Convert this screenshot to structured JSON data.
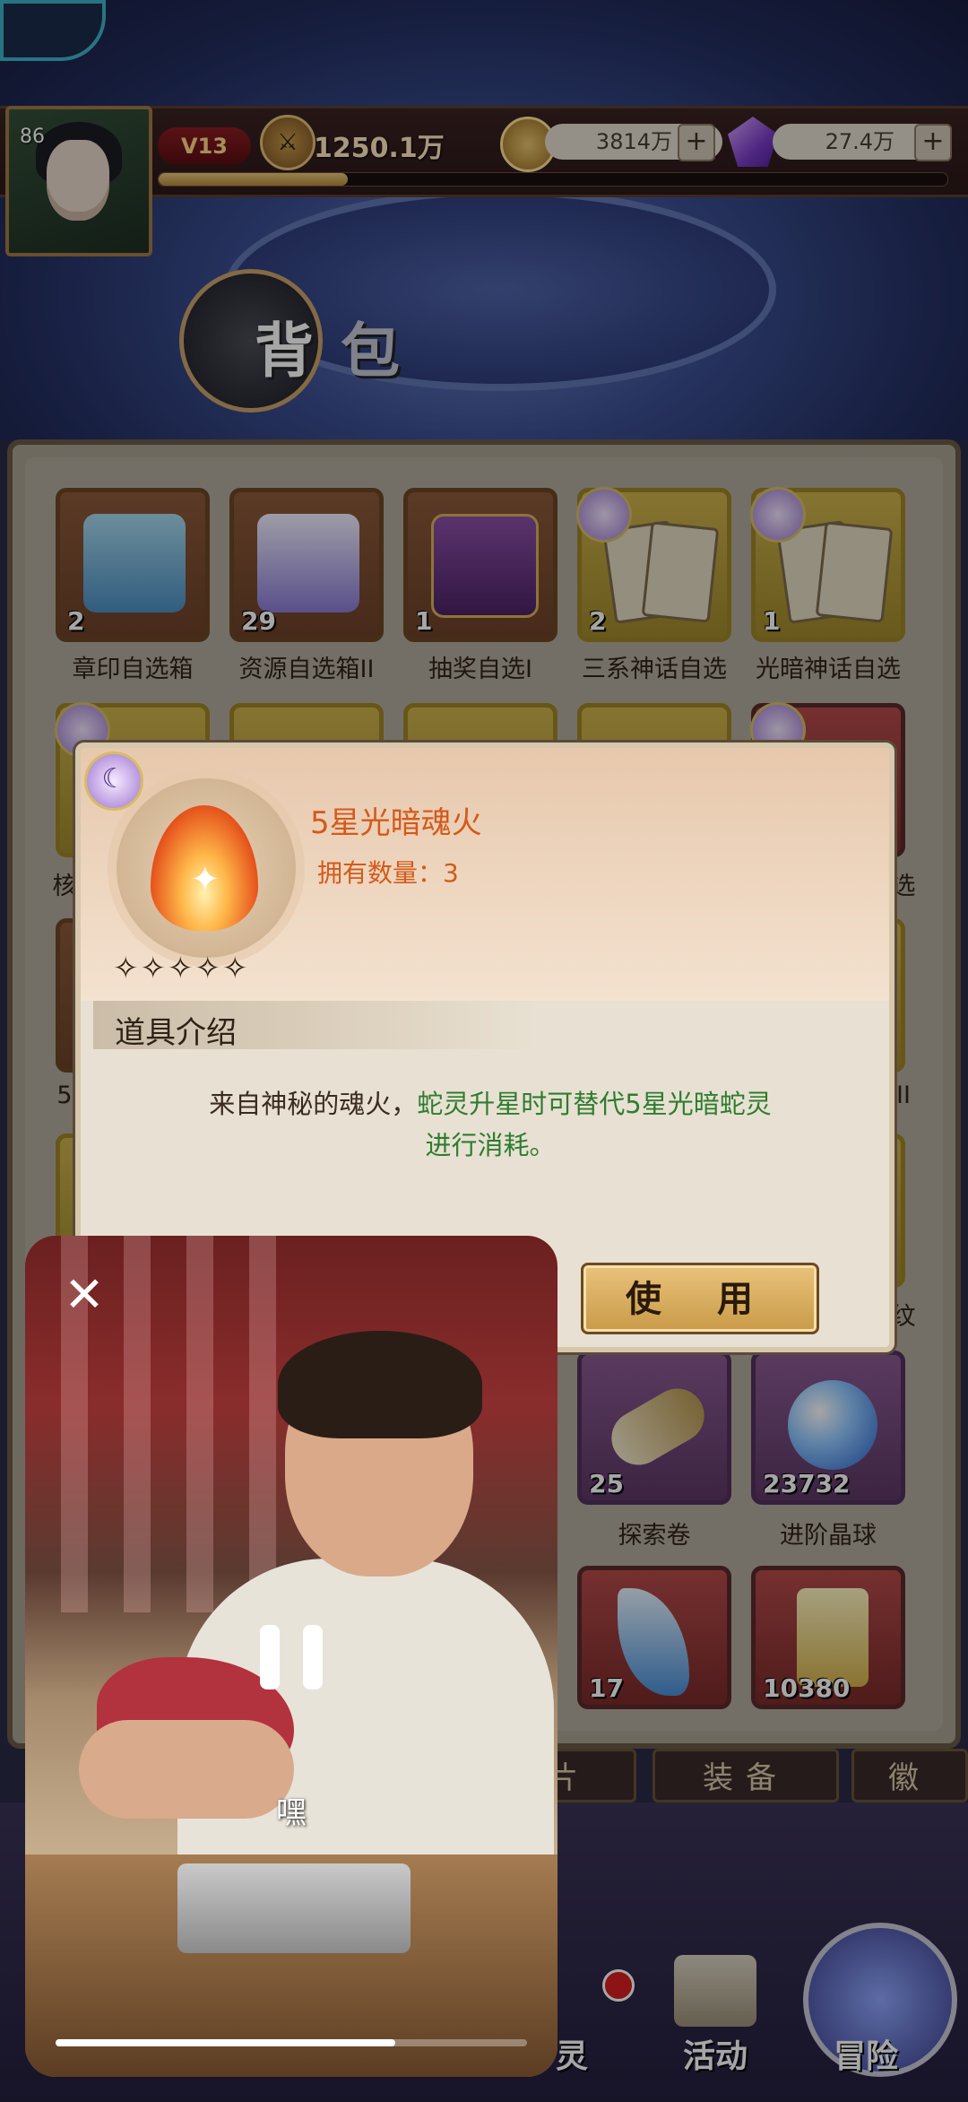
{
  "header": {
    "level": "86",
    "vip": "V13",
    "power": "1250.1万",
    "gold": "3814万",
    "gems": "27.4万",
    "plus": "+",
    "exp_progress": 0.24
  },
  "page_title": {
    "char1": "背",
    "char2": "包"
  },
  "bag": {
    "row1": [
      {
        "count": "2",
        "label": "章印自选箱"
      },
      {
        "count": "29",
        "label": "资源自选箱II"
      },
      {
        "count": "1",
        "label": "抽奖自选I"
      },
      {
        "count": "2",
        "label": "三系神话自选"
      },
      {
        "count": "1",
        "label": "光暗神话自选"
      }
    ],
    "partial_labels": {
      "row2_left": "核",
      "row2_right": "选",
      "row3_left": "5",
      "row3_right": "II",
      "row4_right": "纹"
    },
    "row5": [
      {
        "count": "25",
        "label": "探索卷"
      },
      {
        "count": "23732",
        "label": "进阶晶球"
      }
    ],
    "row6": [
      {
        "count": "17"
      },
      {
        "count": "10380"
      }
    ],
    "tabs": [
      "片",
      "装备",
      "徽"
    ]
  },
  "nav": {
    "item_left": "灵",
    "item_mid": "活动",
    "item_right": "冒险"
  },
  "popup": {
    "item_name": "5星光暗魂火",
    "owned_label": "拥有数量：3",
    "stars": "✧✧✧✧✧",
    "moon_icon": "☾",
    "section_title": "道具介绍",
    "desc_plain": "来自神秘的魂火，",
    "desc_green_1": "蛇灵升星时可替代5星光暗蛇灵",
    "desc_green_2": "进行消耗。",
    "use_button": "使 用"
  },
  "video": {
    "close": "✕",
    "subtitle": "嘿",
    "progress": 0.72
  }
}
